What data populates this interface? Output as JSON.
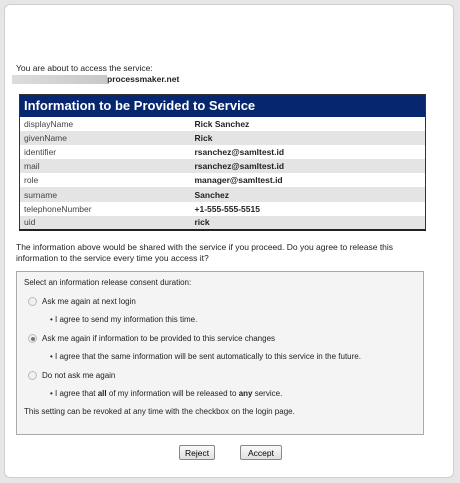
{
  "intro": "You are about to access the service:",
  "service_suffix": "processmaker.net",
  "table": {
    "title": "Information to be Provided to Service",
    "rows": [
      [
        "displayName",
        "Rick Sanchez"
      ],
      [
        "givenName",
        "Rick"
      ],
      [
        "identifier",
        "rsanchez@samltest.id"
      ],
      [
        "mail",
        "rsanchez@samltest.id"
      ],
      [
        "role",
        "manager@samltest.id"
      ],
      [
        "surname",
        "Sanchez"
      ],
      [
        "telephoneNumber",
        "+1-555-555-5515"
      ],
      [
        "uid",
        "rick"
      ]
    ]
  },
  "paragraph": "The information above would be shared with the service if you proceed. Do you agree to release this information to the service every time you access it?",
  "consent": {
    "label": "Select an information release consent duration:",
    "options": [
      {
        "label": "Ask me again at next login",
        "desc": "I agree to send my information this time.",
        "selected": false
      },
      {
        "label": "Ask me again if information to be provided to this service changes",
        "desc": "I agree that the same information will be sent automatically to this service in the future.",
        "selected": true
      },
      {
        "label": "Do not ask me again",
        "desc_a": "I agree that ",
        "desc_b": "all",
        "desc_c": " of my information will be released to ",
        "desc_d": "any",
        "desc_e": " service.",
        "selected": false
      }
    ],
    "revoke": "This setting can be revoked at any time with the checkbox on the login page."
  },
  "buttons": {
    "reject": "Reject",
    "accept": "Accept"
  }
}
